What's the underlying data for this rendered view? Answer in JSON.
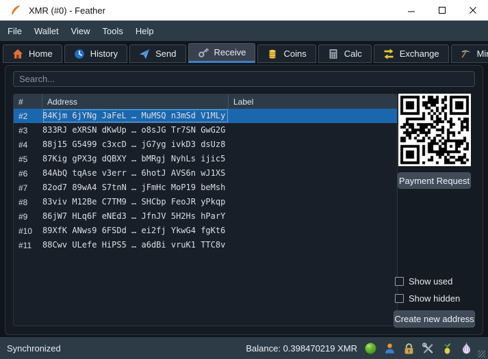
{
  "window": {
    "title": "XMR (#0) - Feather"
  },
  "menu": {
    "items": [
      "File",
      "Wallet",
      "View",
      "Tools",
      "Help"
    ]
  },
  "tabs": [
    {
      "label": "Home",
      "icon": "home-icon",
      "active": false
    },
    {
      "label": "History",
      "icon": "history-icon",
      "active": false
    },
    {
      "label": "Send",
      "icon": "send-icon",
      "active": false
    },
    {
      "label": "Receive",
      "icon": "receive-icon",
      "active": true
    },
    {
      "label": "Coins",
      "icon": "coins-icon",
      "active": false
    },
    {
      "label": "Calc",
      "icon": "calc-icon",
      "active": false
    },
    {
      "label": "Exchange",
      "icon": "exchange-icon",
      "active": false
    },
    {
      "label": "Mining",
      "icon": "mining-icon",
      "active": false
    }
  ],
  "search": {
    "placeholder": "Search..."
  },
  "table": {
    "columns": [
      "#",
      "Address",
      "Label"
    ],
    "rows": [
      {
        "index": "#2",
        "address": "84Kjm 6jYNg JaFeL … MuMSQ n3mSd V1MLy",
        "label": "",
        "selected": true
      },
      {
        "index": "#3",
        "address": "833RJ eXRSN dKwUp … o8sJG Tr7SN GwG2G",
        "label": "",
        "selected": false
      },
      {
        "index": "#4",
        "address": "88j15 G5499 c3xcD … jG7yg ivkD3 dsUz8",
        "label": "",
        "selected": false
      },
      {
        "index": "#5",
        "address": "87Kig gPX3g dQBXY … bMRgj NyhLs ijic5",
        "label": "",
        "selected": false
      },
      {
        "index": "#6",
        "address": "84AbQ tqAse v3err … 6hotJ AVS6n wJ1XS",
        "label": "",
        "selected": false
      },
      {
        "index": "#7",
        "address": "82od7 89wA4 S7tnN … jFmHc MoP19 beMsh",
        "label": "",
        "selected": false
      },
      {
        "index": "#8",
        "address": "83viv M12Be C7TM9 … SHCbp FeoJR yPkqp",
        "label": "",
        "selected": false
      },
      {
        "index": "#9",
        "address": "86jW7 HLq6F eNEd3 … JfnJV 5H2Hs hParY",
        "label": "",
        "selected": false
      },
      {
        "index": "#10",
        "address": "89XfK ANws9 6FSDd … ei2fj YkwG4 fgKt6",
        "label": "",
        "selected": false
      },
      {
        "index": "#11",
        "address": "88Cwv ULefe HiPS5 … a6dBi vruK1 TTC8v",
        "label": "",
        "selected": false
      }
    ]
  },
  "receive_panel": {
    "payment_request_label": "Payment Request",
    "show_used": {
      "label": "Show used",
      "checked": false
    },
    "show_hidden": {
      "label": "Show hidden",
      "checked": false
    },
    "create_address_label": "Create new address"
  },
  "status_bar": {
    "status": "Synchronized",
    "balance": "Balance: 0.398470219 XMR",
    "icons": [
      "network-status-icon",
      "account-icon",
      "lock-icon",
      "tools-icon",
      "seed-icon",
      "onion-icon"
    ]
  },
  "colors": {
    "titlebar_bg": "#ffffff",
    "chrome_bg": "#2d3b47",
    "window_bg": "#10151c",
    "panel_bg": "#151b23",
    "selection_blue": "#1b67ae",
    "tab_underline_blue": "#3c82c8",
    "status_green": "#54a82e",
    "feather_orange": "#e87931"
  }
}
